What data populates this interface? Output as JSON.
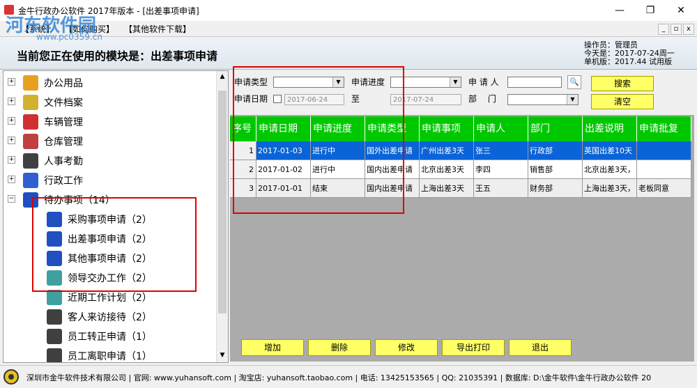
{
  "window": {
    "title": "金牛行政办公软件 2017年版本 - [出差事项申请]",
    "minimize": "—",
    "maximize": "❐",
    "close": "✕"
  },
  "watermark": {
    "text": "河东软件园",
    "url": "www.pc0359.cn"
  },
  "menu": [
    {
      "label": "【系统】"
    },
    {
      "label": "【如何购买】"
    },
    {
      "label": "【其他软件下载】"
    }
  ],
  "mdi": {
    "minimize": "_",
    "restore": "▫",
    "close": "x"
  },
  "header": {
    "module_label": "当前您正在使用的模块是：出差事项申请",
    "operator": "操作员：管理员",
    "today": "今天是：2017-07-24周一",
    "version": "单机版：2017.44 试用版"
  },
  "tree": [
    {
      "label": "办公用品",
      "icon": "office-supplies-icon",
      "color": "#e8a020",
      "expander": "+"
    },
    {
      "label": "文件档案",
      "icon": "file-archive-icon",
      "color": "#d4b030",
      "expander": "+"
    },
    {
      "label": "车辆管理",
      "icon": "car-icon",
      "color": "#d03030",
      "expander": "+"
    },
    {
      "label": "仓库管理",
      "icon": "warehouse-icon",
      "color": "#c04040",
      "expander": "+"
    },
    {
      "label": "人事考勤",
      "icon": "person-icon",
      "color": "#404040",
      "expander": "+"
    },
    {
      "label": "行政工作",
      "icon": "admin-work-icon",
      "color": "#3060d0",
      "expander": "+"
    },
    {
      "label": "待办事项（14）",
      "icon": "todo-icon",
      "color": "#2050c0",
      "expander": "−"
    },
    {
      "label": "采购事项申请（2）",
      "icon": "pen-note-icon",
      "color": "#2050c0",
      "child": true
    },
    {
      "label": "出差事项申请（2）",
      "icon": "pen-note-icon",
      "color": "#2050c0",
      "child": true
    },
    {
      "label": "其他事项申请（2）",
      "icon": "pen-note-icon",
      "color": "#2050c0",
      "child": true
    },
    {
      "label": "领导交办工作（2）",
      "icon": "notebook-icon",
      "color": "#40a0a0",
      "child": true
    },
    {
      "label": "近期工作计划（2）",
      "icon": "notebook-icon",
      "color": "#40a0a0",
      "child": true
    },
    {
      "label": "客人来访接待（2）",
      "icon": "person-icon",
      "color": "#404040",
      "child": true
    },
    {
      "label": "员工转正申请（1）",
      "icon": "person-icon",
      "color": "#404040",
      "child": true
    },
    {
      "label": "员工离职申请（1）",
      "icon": "person-icon",
      "color": "#404040",
      "child": true
    }
  ],
  "filters": {
    "type_label": "申请类型",
    "progress_label": "申请进度",
    "applicant_label": "申 请 人",
    "date_label": "申请日期",
    "date_from": "2017-06-24",
    "to_label": "至",
    "date_to": "2017-07-24",
    "dept_label": "部　 门",
    "search_button": "搜索",
    "clear_button": "清空"
  },
  "grid": {
    "headers": [
      "序号",
      "申请日期",
      "申请进度",
      "申请类型",
      "申请事项",
      "申请人",
      "部门",
      "出差说明",
      "申请批复"
    ],
    "rows": [
      [
        "1",
        "2017-01-03",
        "进行中",
        "国外出差申请",
        "广州出差3天",
        "张三",
        "行政部",
        "英国出差10天",
        ""
      ],
      [
        "2",
        "2017-01-02",
        "进行中",
        "国内出差申请",
        "北京出差3天",
        "李四",
        "销售部",
        "北京出差3天，",
        ""
      ],
      [
        "3",
        "2017-01-01",
        "结束",
        "国内出差申请",
        "上海出差3天",
        "王五",
        "财务部",
        "上海出差3天，",
        "老板同意"
      ]
    ],
    "selected_row": 0,
    "selected_color": "#0a64d8",
    "header_color": "#00c800"
  },
  "actions": {
    "add": "增加",
    "delete": "删除",
    "edit": "修改",
    "export": "导出打印",
    "exit": "退出"
  },
  "status": {
    "text": "深圳市金牛软件技术有限公司 | 官网: www.yuhansoft.com | 淘宝店: yuhansoft.taobao.com | 电话: 13425153565 | QQ: 21035391 | 数据库: D:\\金牛软件\\金牛行政办公软件 20"
  }
}
